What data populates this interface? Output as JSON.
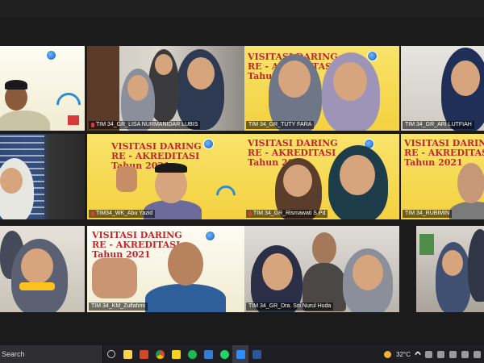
{
  "window": {
    "title": ""
  },
  "participants": [
    {
      "id": "t1",
      "name": "",
      "banner": {
        "line1": "",
        "line2": ""
      }
    },
    {
      "id": "t2",
      "name": "TIM 34_GR_LISA NURMANIDAR LUBIS",
      "mic_muted": true
    },
    {
      "id": "t3",
      "name": "TIM 34_GR_TUTY FARA",
      "banner": {
        "line1": "VISITASI DARING",
        "line2": "RE - AKREDITASI",
        "line3": "Tahun 2021"
      }
    },
    {
      "id": "t4",
      "name": "TIM 34_GR_ARI LUTFIAH"
    },
    {
      "id": "t5",
      "name": ""
    },
    {
      "id": "t6",
      "name": "TIM34_WK_Abu Yazid",
      "mic_muted": true,
      "active": true,
      "banner": {
        "line1": "VISITASI DARING",
        "line2": "RE - AKREDITASI",
        "line3": "Tahun 2021"
      }
    },
    {
      "id": "t7",
      "name": "TIM 34_GR_Rismawati S.Pd",
      "mic_muted": true,
      "banner": {
        "line1": "VISITASI DARING",
        "line2": "RE - AKREDITASI",
        "line3": "Tahun 2021"
      }
    },
    {
      "id": "t8",
      "name": "TIM 34_RUBIMIN",
      "banner": {
        "line1": "VISITASI DARING",
        "line2": "RE - AKREDITASI",
        "line3": "Tahun 2021"
      }
    },
    {
      "id": "t9",
      "name": ""
    },
    {
      "id": "t10",
      "name": "TIM 34_KM_Zulfahmi",
      "banner": {
        "line1": "VISITASI DARING",
        "line2": "RE - AKREDITASI",
        "line3": "Tahun 2021"
      }
    },
    {
      "id": "t11",
      "name": "TIM 34_GR_Dra. Siti Nurul Huda"
    },
    {
      "id": "t12",
      "name": ""
    }
  ],
  "taskbar": {
    "search_placeholder": "Search",
    "apps": [
      "task-view-icon",
      "file-explorer-icon",
      "powerpoint-icon",
      "chrome-icon",
      "sticky-notes-icon",
      "spotify-icon",
      "edge-icon",
      "whatsapp-icon",
      "zoom-icon",
      "word-icon"
    ],
    "weather": "32°C"
  },
  "colors": {
    "active_border": "#f3e21b",
    "banner_red": "#c0262d",
    "banner_yellow": "#f4d13f"
  }
}
